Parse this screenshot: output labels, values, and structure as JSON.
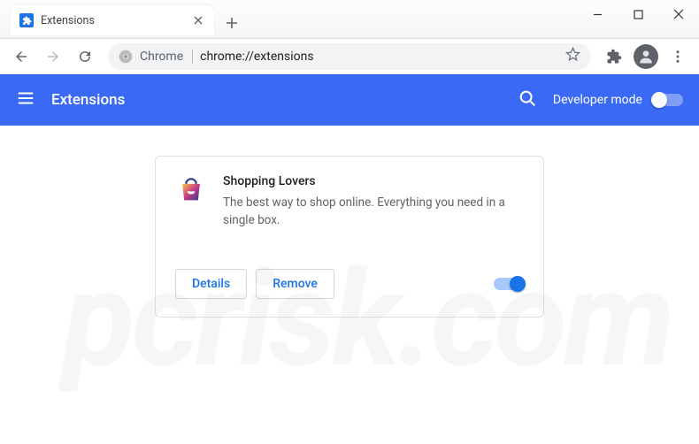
{
  "window": {
    "tab_title": "Extensions"
  },
  "toolbar": {
    "chip": "Chrome",
    "url": "chrome://extensions"
  },
  "page": {
    "title": "Extensions",
    "developer_mode_label": "Developer mode",
    "developer_mode_on": false
  },
  "extension": {
    "name": "Shopping Lovers",
    "description": "The best way to shop online. Everything you need in a single box.",
    "enabled": true,
    "buttons": {
      "details": "Details",
      "remove": "Remove"
    }
  },
  "watermark": "pcrisk.com"
}
